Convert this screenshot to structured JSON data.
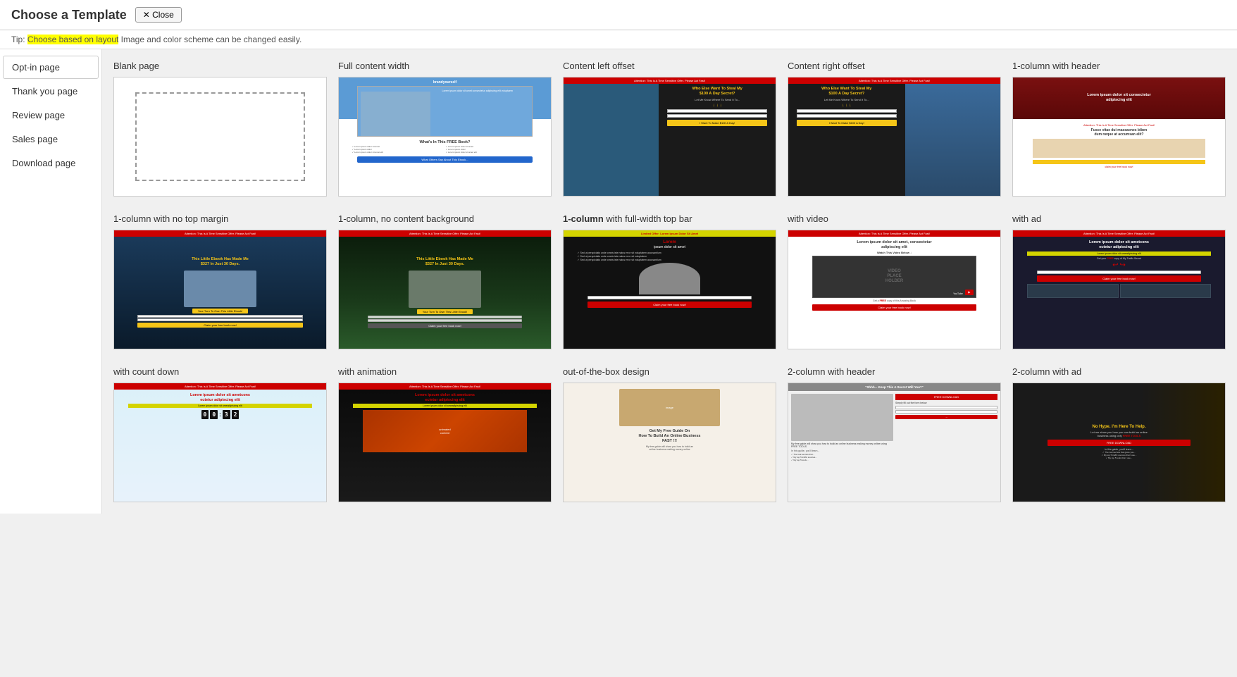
{
  "header": {
    "title": "Choose a Template",
    "close_label": "✕ Close"
  },
  "tip": {
    "prefix": "Tip: ",
    "highlight": "Choose based on layout",
    "suffix": " Image and color scheme can be changed easily."
  },
  "sidebar": {
    "items": [
      {
        "id": "opt-in",
        "label": "Opt-in page",
        "active": true
      },
      {
        "id": "thank-you",
        "label": "Thank you page",
        "active": false
      },
      {
        "id": "review",
        "label": "Review page",
        "active": false
      },
      {
        "id": "sales",
        "label": "Sales page",
        "active": false
      },
      {
        "id": "download",
        "label": "Download page",
        "active": false
      }
    ]
  },
  "templates": {
    "row1": [
      {
        "id": "blank",
        "title": "Blank page",
        "style": "blank"
      },
      {
        "id": "full-content",
        "title": "Full content width",
        "style": "full-content"
      },
      {
        "id": "content-left",
        "title": "Content left offset",
        "style": "content-left"
      },
      {
        "id": "content-right",
        "title": "Content right offset",
        "style": "content-right"
      },
      {
        "id": "1col-header",
        "title": "1-column with header",
        "style": "1col-header"
      }
    ],
    "row2": [
      {
        "id": "1col-no-margin",
        "title": "1-column with no top margin",
        "style": "1col-no-margin"
      },
      {
        "id": "1col-no-bg",
        "title": "1-column, no content background",
        "style": "1col-no-bg"
      },
      {
        "id": "1col-fullbar",
        "title": "1-column with full-width top bar",
        "style": "1col-fullbar"
      },
      {
        "id": "with-video",
        "title": "with video",
        "style": "with-video"
      },
      {
        "id": "with-ad",
        "title": "with ad",
        "style": "with-ad"
      }
    ],
    "row3": [
      {
        "id": "with-countdown",
        "title": "with count down",
        "style": "with-countdown"
      },
      {
        "id": "with-animation",
        "title": "with animation",
        "style": "with-animation"
      },
      {
        "id": "out-of-box",
        "title": "out-of-the-box design",
        "style": "out-of-box"
      },
      {
        "id": "2col-header",
        "title": "2-column with header",
        "style": "2col-header"
      },
      {
        "id": "2col-ad",
        "title": "2-column with ad",
        "style": "2col-ad"
      }
    ]
  }
}
